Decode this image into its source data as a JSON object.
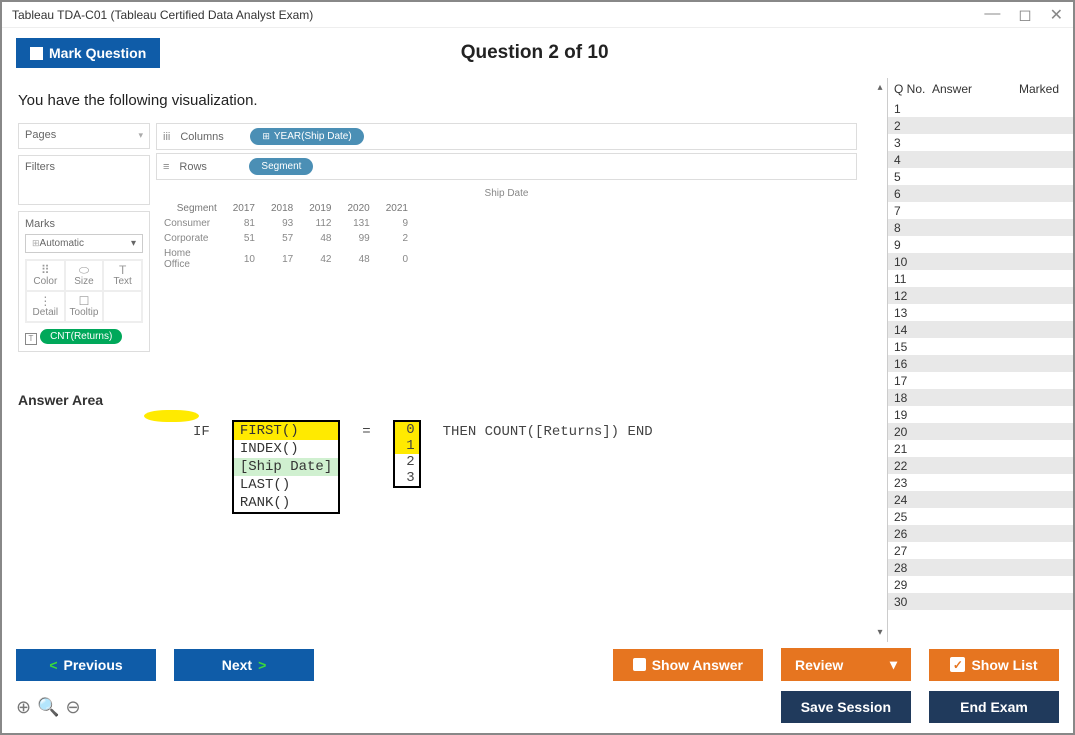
{
  "window_title": "Tableau TDA-C01 (Tableau Certified Data Analyst Exam)",
  "header": {
    "mark_label": "Mark Question",
    "question_title": "Question 2 of 10"
  },
  "question": {
    "prompt": "You have the following visualization.",
    "answer_area_label": "Answer Area"
  },
  "shelves": {
    "pages": "Pages",
    "filters": "Filters",
    "marks_title": "Marks",
    "marks_type": "Automatic",
    "marks_cells": {
      "color": "Color",
      "size": "Size",
      "text": "Text",
      "detail": "Detail",
      "tooltip": "Tooltip"
    },
    "cnt_pill": "CNT(Returns)",
    "columns_label": "Columns",
    "rows_label": "Rows",
    "columns_pill": "YEAR(Ship Date)",
    "rows_pill": "Segment"
  },
  "crosstab": {
    "header": "Ship Date",
    "col_segment": "Segment",
    "years": [
      "2017",
      "2018",
      "2019",
      "2020",
      "2021"
    ],
    "rows": [
      {
        "seg": "Consumer",
        "vals": [
          "81",
          "93",
          "112",
          "131",
          "9"
        ]
      },
      {
        "seg": "Corporate",
        "vals": [
          "51",
          "57",
          "48",
          "99",
          "2"
        ]
      },
      {
        "seg": "Home Office",
        "vals": [
          "10",
          "17",
          "42",
          "48",
          "0"
        ]
      }
    ]
  },
  "formula": {
    "if": "IF",
    "options1": [
      "FIRST()",
      "INDEX()",
      "[Ship Date]",
      "LAST()",
      "RANK()"
    ],
    "eq": "=",
    "options2": [
      "0",
      "1",
      "2",
      "3"
    ],
    "tail": "THEN COUNT([Returns]) END"
  },
  "qlist": {
    "h1": "Q No.",
    "h2": "Answer",
    "h3": "Marked",
    "count": 30
  },
  "footer": {
    "previous": "Previous",
    "next": "Next",
    "show_answer": "Show Answer",
    "review": "Review",
    "show_list": "Show List",
    "save_session": "Save Session",
    "end_exam": "End Exam"
  }
}
